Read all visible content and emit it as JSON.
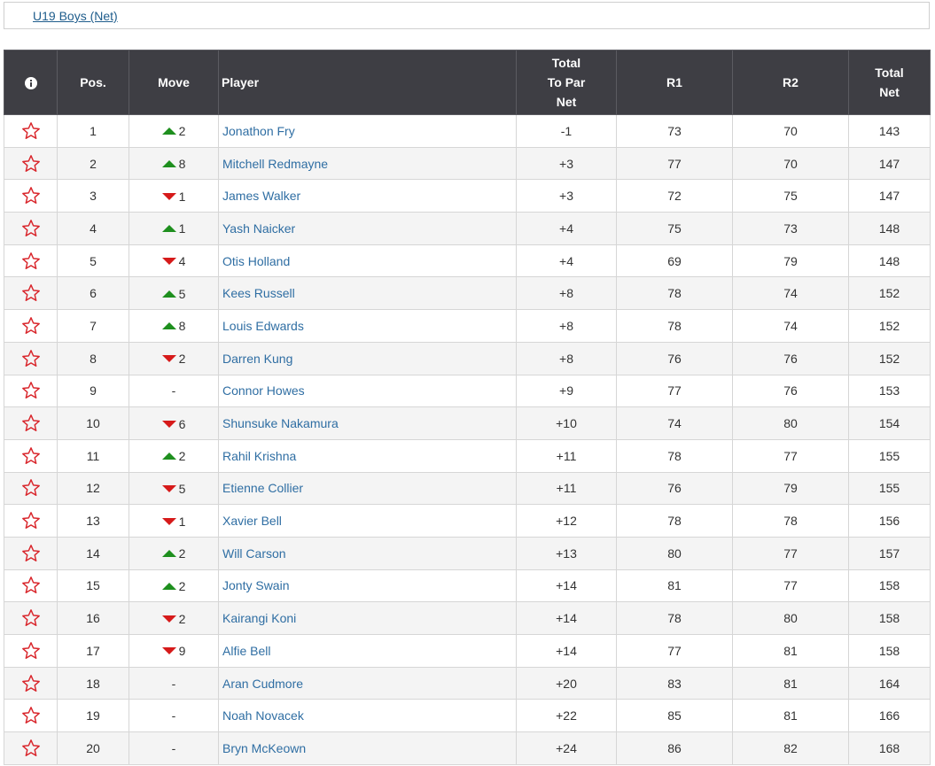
{
  "tab": {
    "label": "U19 Boys (Net)"
  },
  "table": {
    "headers": {
      "pos": "Pos.",
      "move": "Move",
      "player": "Player",
      "to_par_1": "Total",
      "to_par_2": "To Par",
      "to_par_3": "Net",
      "r1": "R1",
      "r2": "R2",
      "total_1": "Total",
      "total_2": "Net"
    },
    "rows": [
      {
        "pos": "1",
        "dir": "up",
        "move": "2",
        "player": "Jonathon Fry",
        "topar": "-1",
        "r1": "73",
        "r2": "70",
        "total": "143"
      },
      {
        "pos": "2",
        "dir": "up",
        "move": "8",
        "player": "Mitchell Redmayne",
        "topar": "+3",
        "r1": "77",
        "r2": "70",
        "total": "147"
      },
      {
        "pos": "3",
        "dir": "down",
        "move": "1",
        "player": "James Walker",
        "topar": "+3",
        "r1": "72",
        "r2": "75",
        "total": "147"
      },
      {
        "pos": "4",
        "dir": "up",
        "move": "1",
        "player": "Yash Naicker",
        "topar": "+4",
        "r1": "75",
        "r2": "73",
        "total": "148"
      },
      {
        "pos": "5",
        "dir": "down",
        "move": "4",
        "player": "Otis Holland",
        "topar": "+4",
        "r1": "69",
        "r2": "79",
        "total": "148"
      },
      {
        "pos": "6",
        "dir": "up",
        "move": "5",
        "player": "Kees Russell",
        "topar": "+8",
        "r1": "78",
        "r2": "74",
        "total": "152"
      },
      {
        "pos": "7",
        "dir": "up",
        "move": "8",
        "player": "Louis Edwards",
        "topar": "+8",
        "r1": "78",
        "r2": "74",
        "total": "152"
      },
      {
        "pos": "8",
        "dir": "down",
        "move": "2",
        "player": "Darren Kung",
        "topar": "+8",
        "r1": "76",
        "r2": "76",
        "total": "152"
      },
      {
        "pos": "9",
        "dir": "none",
        "move": "-",
        "player": "Connor Howes",
        "topar": "+9",
        "r1": "77",
        "r2": "76",
        "total": "153"
      },
      {
        "pos": "10",
        "dir": "down",
        "move": "6",
        "player": "Shunsuke Nakamura",
        "topar": "+10",
        "r1": "74",
        "r2": "80",
        "total": "154"
      },
      {
        "pos": "11",
        "dir": "up",
        "move": "2",
        "player": "Rahil Krishna",
        "topar": "+11",
        "r1": "78",
        "r2": "77",
        "total": "155"
      },
      {
        "pos": "12",
        "dir": "down",
        "move": "5",
        "player": "Etienne Collier",
        "topar": "+11",
        "r1": "76",
        "r2": "79",
        "total": "155"
      },
      {
        "pos": "13",
        "dir": "down",
        "move": "1",
        "player": "Xavier Bell",
        "topar": "+12",
        "r1": "78",
        "r2": "78",
        "total": "156"
      },
      {
        "pos": "14",
        "dir": "up",
        "move": "2",
        "player": "Will Carson",
        "topar": "+13",
        "r1": "80",
        "r2": "77",
        "total": "157"
      },
      {
        "pos": "15",
        "dir": "up",
        "move": "2",
        "player": "Jonty Swain",
        "topar": "+14",
        "r1": "81",
        "r2": "77",
        "total": "158"
      },
      {
        "pos": "16",
        "dir": "down",
        "move": "2",
        "player": "Kairangi Koni",
        "topar": "+14",
        "r1": "78",
        "r2": "80",
        "total": "158"
      },
      {
        "pos": "17",
        "dir": "down",
        "move": "9",
        "player": "Alfie Bell",
        "topar": "+14",
        "r1": "77",
        "r2": "81",
        "total": "158"
      },
      {
        "pos": "18",
        "dir": "none",
        "move": "-",
        "player": "Aran Cudmore",
        "topar": "+20",
        "r1": "83",
        "r2": "81",
        "total": "164"
      },
      {
        "pos": "19",
        "dir": "none",
        "move": "-",
        "player": "Noah Novacek",
        "topar": "+22",
        "r1": "85",
        "r2": "81",
        "total": "166"
      },
      {
        "pos": "20",
        "dir": "none",
        "move": "-",
        "player": "Bryn McKeown",
        "topar": "+24",
        "r1": "86",
        "r2": "82",
        "total": "168"
      }
    ]
  },
  "icons": {
    "info": "info-icon",
    "favorite": "star-outline-icon",
    "move_up": "triangle-up-icon",
    "move_down": "triangle-down-icon"
  },
  "colors": {
    "header_bg": "#3e3e44",
    "link": "#2f6ea3",
    "star": "#d9262c",
    "up": "#1e8f1e",
    "down": "#d61a1a"
  }
}
